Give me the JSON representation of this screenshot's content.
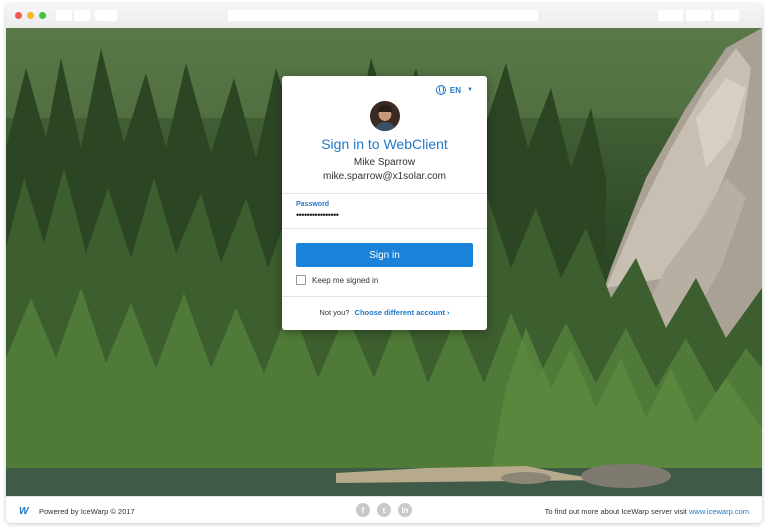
{
  "login": {
    "language": "EN",
    "title": "Sign in to WebClient",
    "user_name": "Mike Sparrow",
    "user_email": "mike.sparrow@x1solar.com",
    "password_label": "Password",
    "password_value": "••••••••••••••••",
    "signin_label": "Sign in",
    "keep_signed_in_label": "Keep me signed in",
    "not_you_text": "Not you?",
    "different_account_link": "Choose different account ›"
  },
  "footer": {
    "logo_text": "W",
    "powered_by": "Powered by IceWarp © 2017",
    "social_icons": [
      "facebook-icon",
      "twitter-icon",
      "linkedin-icon"
    ],
    "facebook_glyph": "f",
    "twitter_glyph": "t",
    "linkedin_glyph": "in",
    "info_text": "To find out more about IceWarp server visit",
    "site_link": "www.icewarp.com"
  },
  "colors": {
    "accent": "#1f78c8",
    "button": "#1a82d8"
  }
}
